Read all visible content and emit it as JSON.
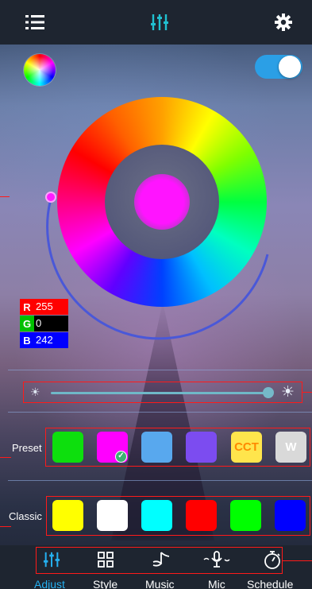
{
  "rgb": {
    "r_label": "R",
    "r_value": "255",
    "g_label": "G",
    "g_value": "0",
    "b_label": "B",
    "b_value": "242",
    "r_color": "#ff0000",
    "g_color": "#00c000",
    "b_color": "#0000ff"
  },
  "power_toggle": {
    "on": true,
    "color": "#2b9fe6"
  },
  "brightness": {
    "level": 0.88
  },
  "selected_color": "#ff14ff",
  "preset": {
    "label": "Preset",
    "swatches": [
      {
        "color": "#0ddf0d",
        "text": ""
      },
      {
        "color": "#ff00ff",
        "text": "",
        "selected": true
      },
      {
        "color": "#58a8ee",
        "text": ""
      },
      {
        "color": "#7c4cf0",
        "text": ""
      },
      {
        "color": "#ffe54c",
        "text": "CCT"
      },
      {
        "color": "#d9d9d9",
        "text": "W"
      }
    ]
  },
  "classic": {
    "label": "Classic",
    "swatches": [
      "#ffff00",
      "#ffffff",
      "#00ffff",
      "#ff0000",
      "#00ff00",
      "#0000ff"
    ]
  },
  "nav": {
    "adjust": "Adjust",
    "style": "Style",
    "music": "Music",
    "mic": "Mic",
    "schedule": "Schedule",
    "active_color": "#25b0f0"
  },
  "icons": {
    "menu": "menu-icon",
    "sliders": "sliders-icon",
    "settings": "gear-icon"
  }
}
